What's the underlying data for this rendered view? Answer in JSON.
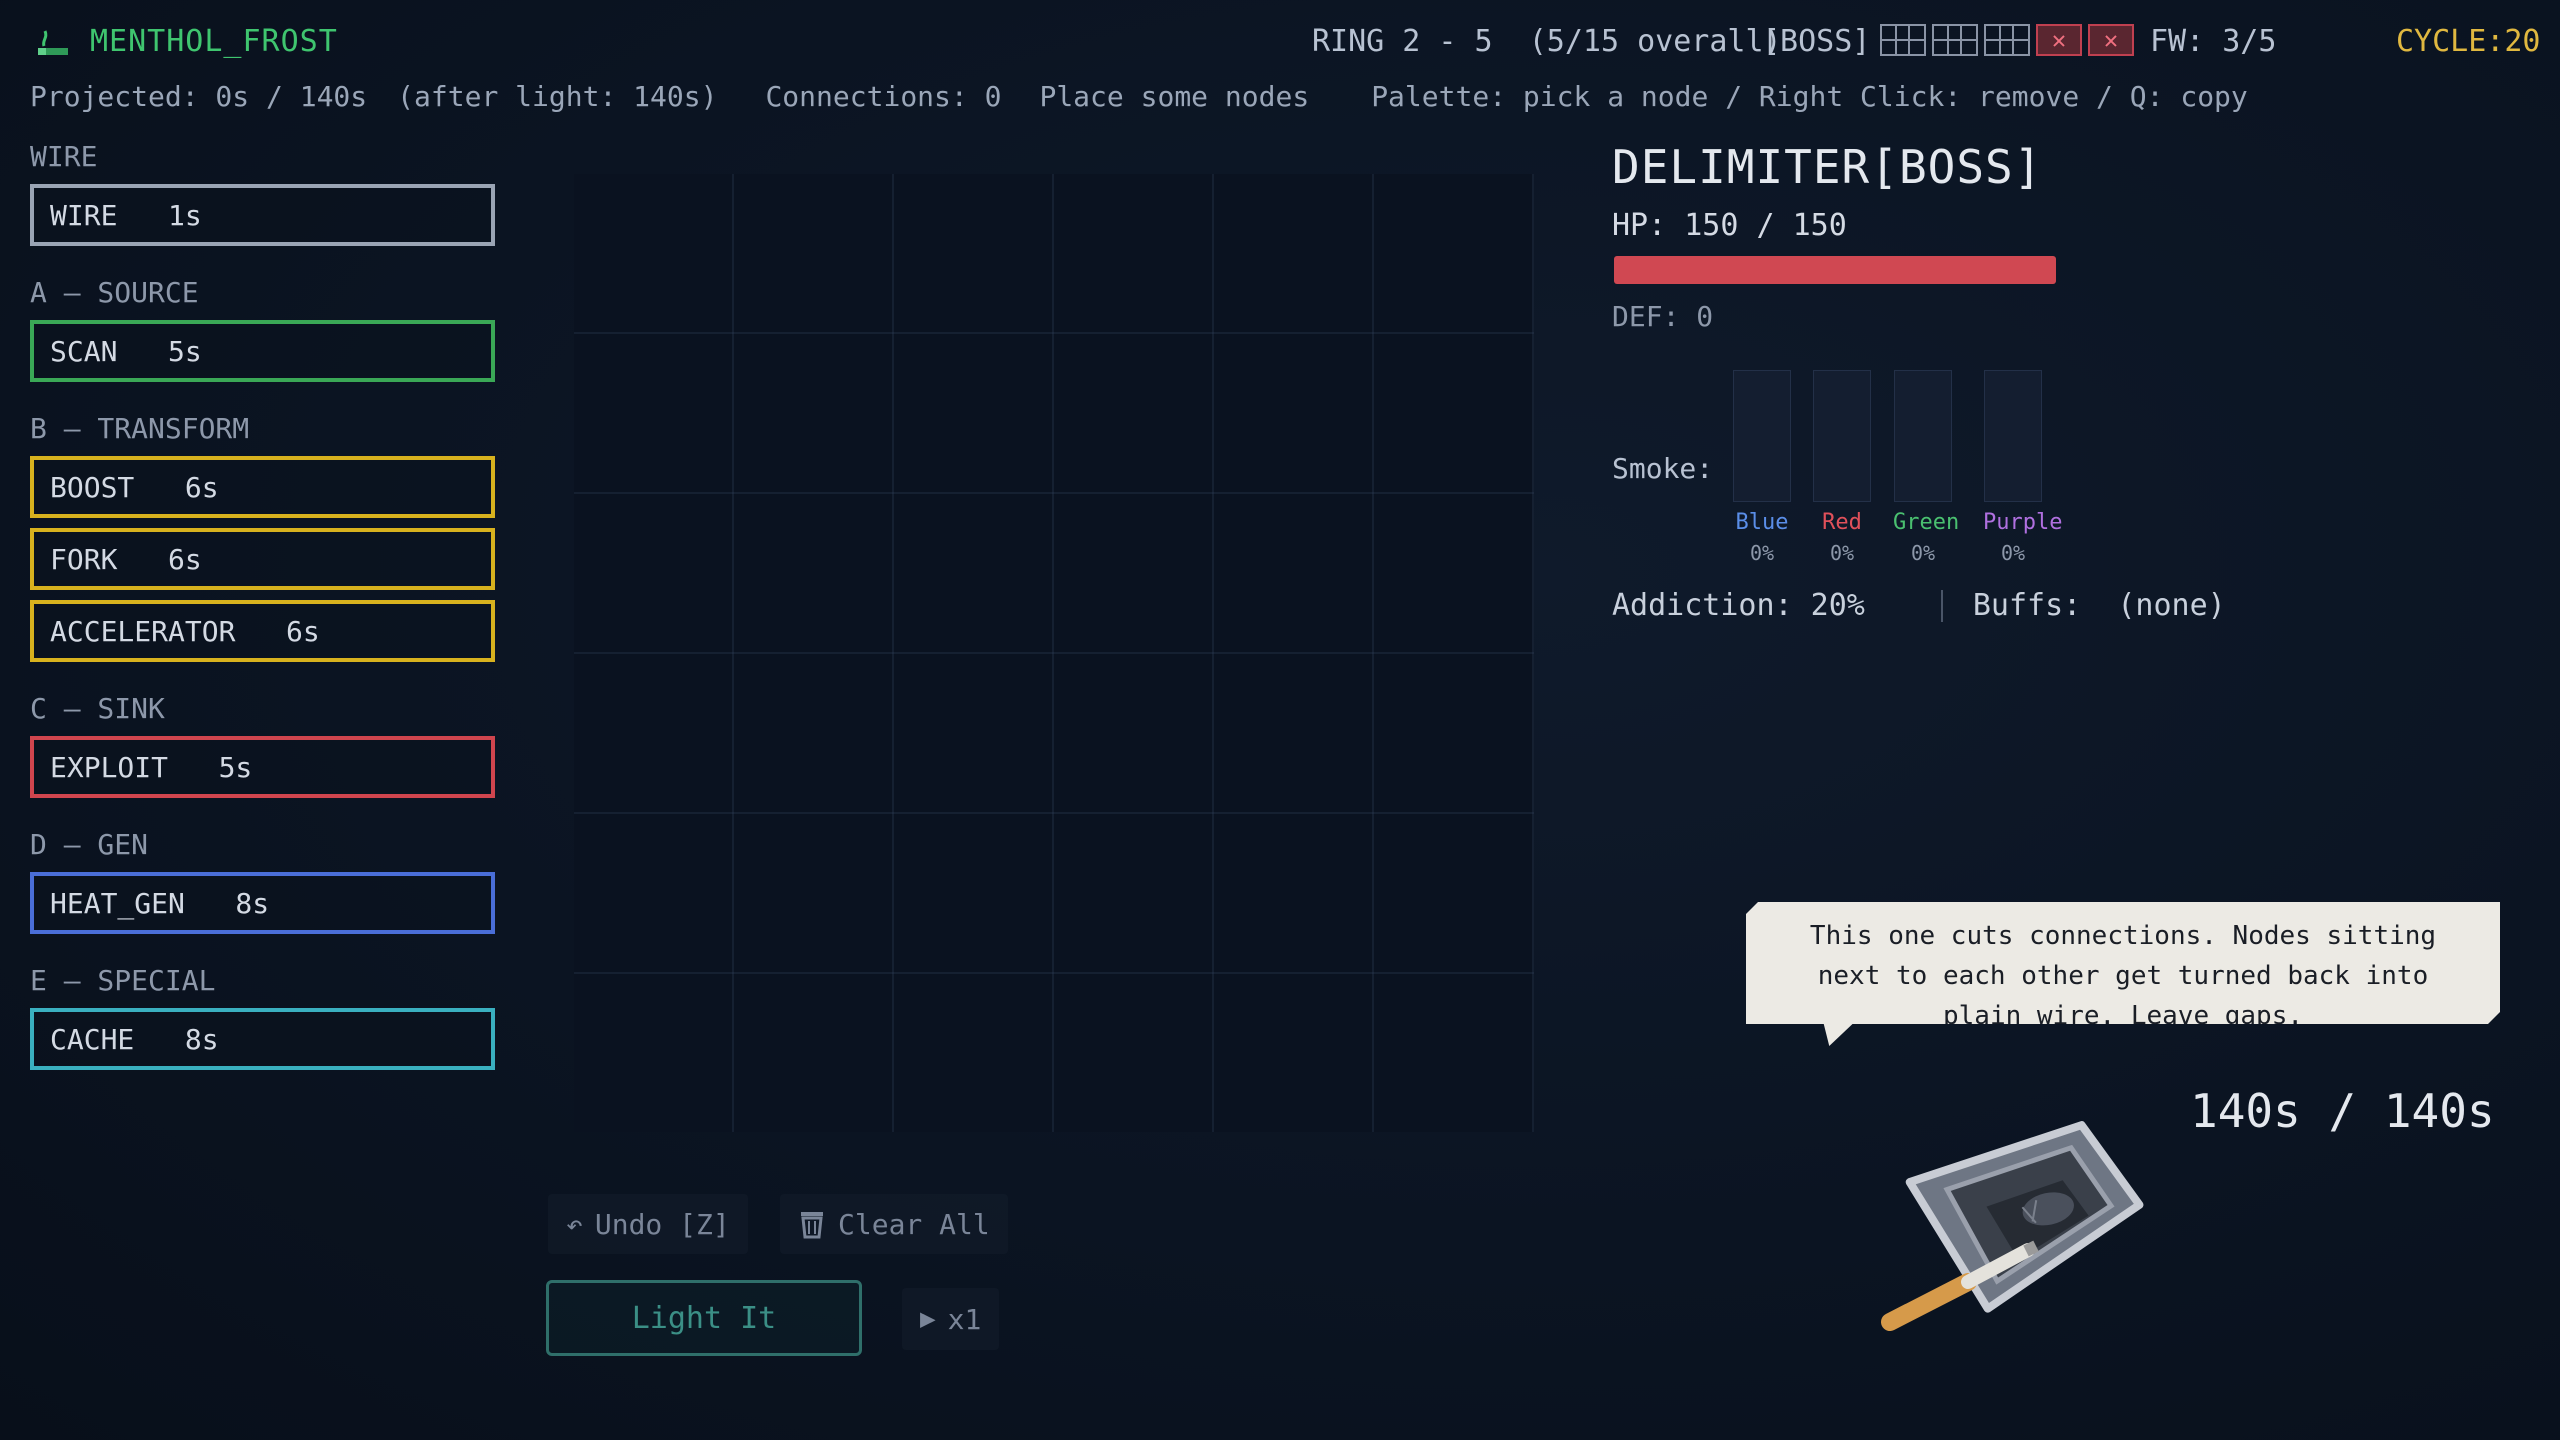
{
  "header": {
    "title": "MENTHOL_FROST",
    "ring": "RING 2 - 5  (5/15 overall)",
    "boss_tag": "[BOSS]",
    "firewall": "FW: 3/5",
    "cycle": "CYCLE:20",
    "stage_icons": [
      "grid",
      "grid",
      "grid",
      "lost",
      "lost"
    ]
  },
  "status": {
    "projected": "Projected: 0s / 140s",
    "after_light": "(after light: 140s)",
    "connections": "Connections: 0",
    "hint": "Place some nodes",
    "controls_hint": "Palette: pick a node / Right Click: remove / Q: copy"
  },
  "palette": {
    "wire": {
      "label": "WIRE",
      "node": "WIRE   1s",
      "color": "#9aa4b4"
    },
    "source": {
      "label": "A — SOURCE",
      "node": "SCAN   5s",
      "color": "#3aa856"
    },
    "transform": {
      "label": "B — TRANSFORM",
      "nodes": [
        "BOOST   6s",
        "FORK   6s",
        "ACCELERATOR   6s"
      ],
      "color": "#d8b21e"
    },
    "sink": {
      "label": "C — SINK",
      "node": "EXPLOIT   5s",
      "color": "#d0454e"
    },
    "gen": {
      "label": "D — GEN",
      "node": "HEAT_GEN   8s",
      "color": "#4a6ed8"
    },
    "special": {
      "label": "E — SPECIAL",
      "node": "CACHE   8s",
      "color": "#3ab0c0"
    }
  },
  "controls": {
    "undo": "Undo [Z]",
    "clear": "Clear All",
    "light": "Light It",
    "speed": "x1"
  },
  "enemy": {
    "name": "DELIMITER[BOSS]",
    "hp_text": "HP: 150 / 150",
    "hp_fraction": 1.0,
    "def_text": "DEF: 0",
    "smoke_label": "Smoke:",
    "smoke": [
      {
        "name": "Blue",
        "pct": "0%",
        "value": 0,
        "color": "#5a8ee8"
      },
      {
        "name": "Red",
        "pct": "0%",
        "value": 0,
        "color": "#e0505a"
      },
      {
        "name": "Green",
        "pct": "0%",
        "value": 0,
        "color": "#4ac070"
      },
      {
        "name": "Purple",
        "pct": "0%",
        "value": 0,
        "color": "#b070e0"
      }
    ],
    "addiction": "Addiction: 20%",
    "buffs": "Buffs:  (none)"
  },
  "dialog": {
    "text": "This one cuts connections. Nodes sitting next to each other get turned back into plain wire. Leave gaps."
  },
  "timer": "140s / 140s"
}
